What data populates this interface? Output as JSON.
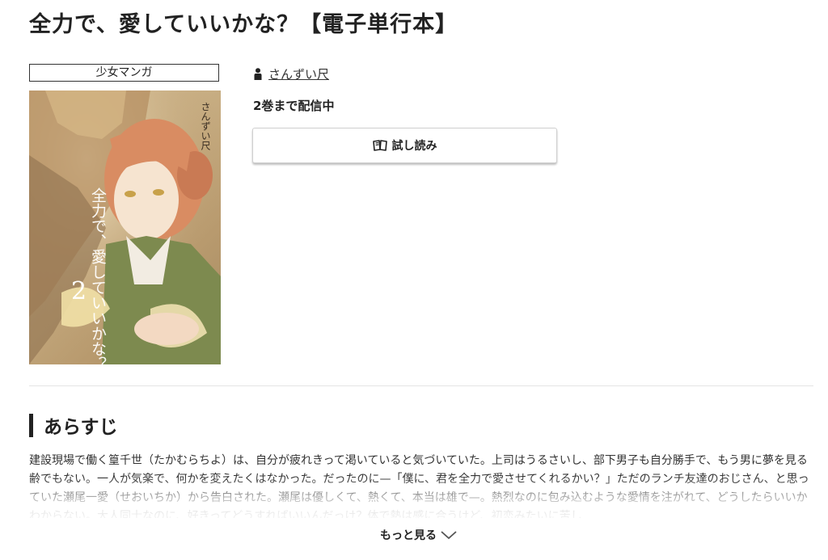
{
  "page": {
    "title": "全力で、愛していいかな？【電子単行本】"
  },
  "book": {
    "genre": "少女マンガ",
    "cover_image": {
      "icon": "manga-cover-image",
      "title_text": "全力で、愛していいかな？",
      "author_text": "さんずい尺",
      "volume": "2"
    },
    "author": "さんずい尺",
    "status": "2巻まで配信中",
    "trial_button": "試し読み"
  },
  "synopsis": {
    "heading": "あらすじ",
    "text": "建設現場で働く篁千世（たかむらちよ）は、自分が疲れきって渇いていると気づいていた。上司はうるさいし、部下男子も自分勝手で、もう男に夢を見る齢でもない。一人が気楽で、何かを変えたくはなかった。だったのに—「僕に、君を全力で愛させてくれるかい？」ただのランチ友達のおじさん、と思っていた瀬尾一愛（せおいちか）から告白された。瀬尾は優しくて、熱くて、本当は雄で—。熱烈なのに包み込むような愛情を注がれて、どうしたらいいかわからない。大人同士なのに、好きってどうすればいいんだっけ？体で熱は感に合うけど、初恋みたいに苦し",
    "more_label": "もっと見る"
  },
  "icons": {
    "author": "person-icon",
    "trial": "open-book-icon",
    "more": "chevron-down-icon"
  }
}
